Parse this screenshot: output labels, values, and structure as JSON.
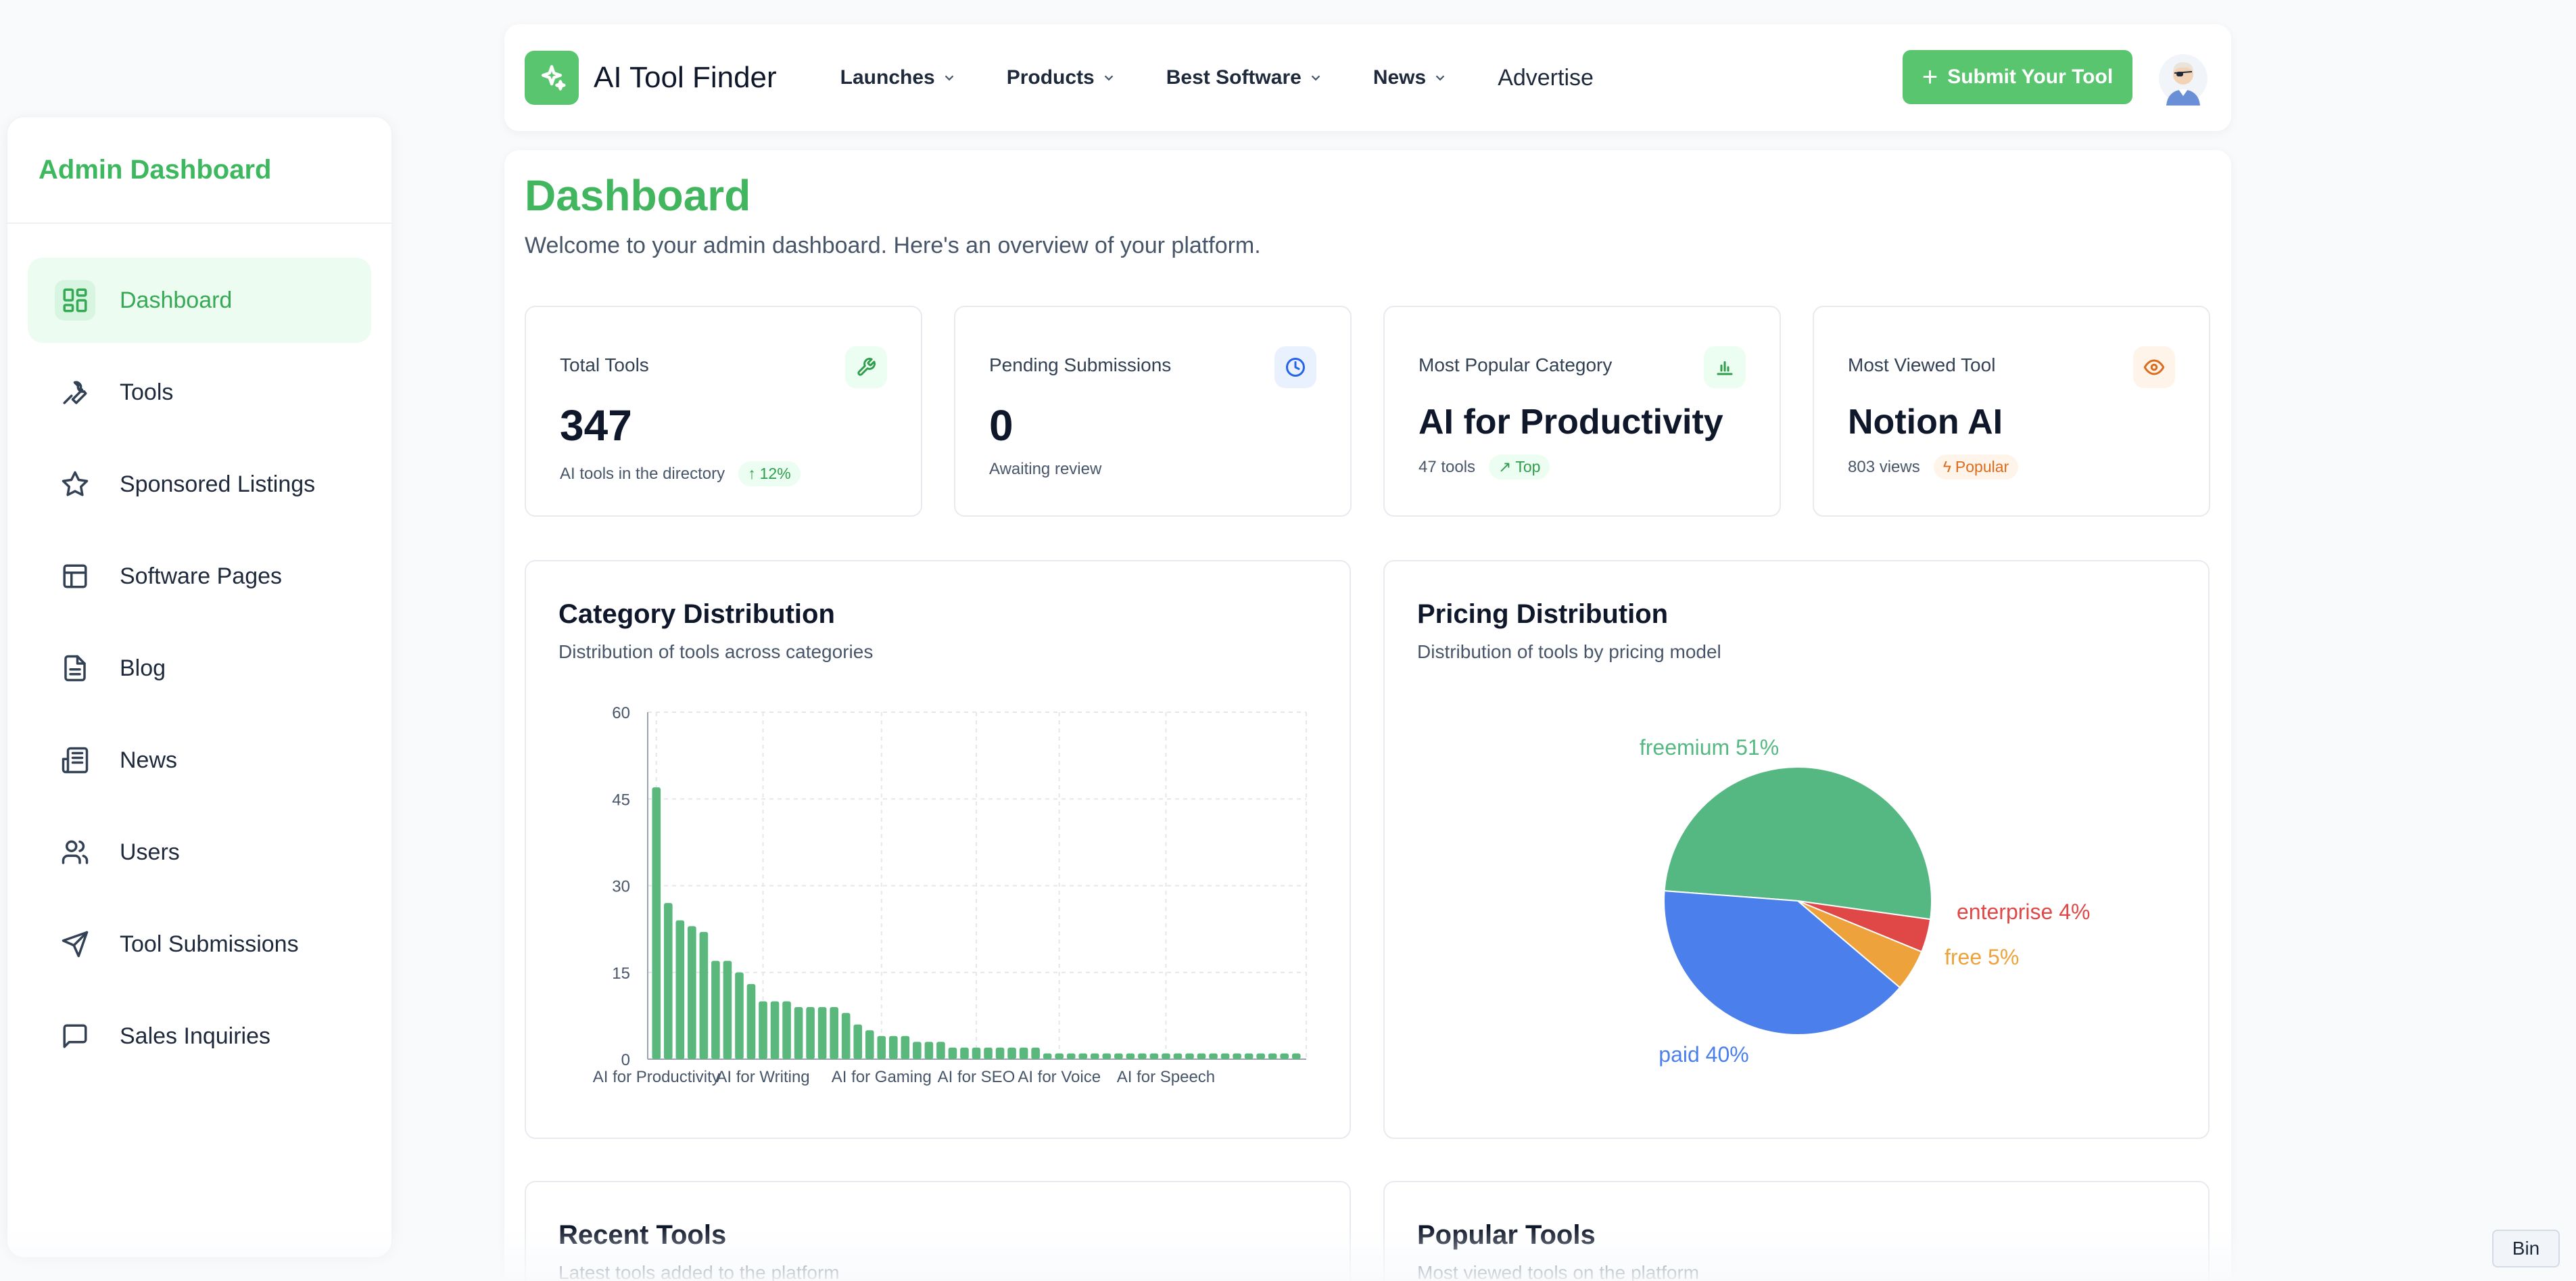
{
  "sidebar": {
    "title": "Admin Dashboard",
    "items": [
      {
        "label": "Dashboard",
        "icon": "dashboard-icon",
        "active": true
      },
      {
        "label": "Tools",
        "icon": "wrench-icon"
      },
      {
        "label": "Sponsored Listings",
        "icon": "star-icon"
      },
      {
        "label": "Software Pages",
        "icon": "layout-icon"
      },
      {
        "label": "Blog",
        "icon": "document-icon"
      },
      {
        "label": "News",
        "icon": "newspaper-icon"
      },
      {
        "label": "Users",
        "icon": "users-icon"
      },
      {
        "label": "Tool Submissions",
        "icon": "send-icon"
      },
      {
        "label": "Sales Inquiries",
        "icon": "message-icon"
      }
    ]
  },
  "header": {
    "brand": "AI Tool Finder",
    "menu": [
      "Launches",
      "Products",
      "Best Software",
      "News"
    ],
    "advertise": "Advertise",
    "submit_label": "Submit Your Tool"
  },
  "page": {
    "title": "Dashboard",
    "subtitle": "Welcome to your admin dashboard. Here's an overview of your platform."
  },
  "stats": [
    {
      "label": "Total Tools",
      "value": "347",
      "foot": "AI tools in the directory",
      "badge": "12%",
      "icon": "wrench-icon",
      "accent": "#2f9e4c"
    },
    {
      "label": "Pending Submissions",
      "value": "0",
      "foot": "Awaiting review",
      "badge": "",
      "icon": "clock-icon",
      "accent": "#2563eb"
    },
    {
      "label": "Most Popular Category",
      "value": "AI for Productivity",
      "foot": "47 tools",
      "badge": "Top",
      "icon": "bar-chart-icon",
      "accent": "#2f9e4c"
    },
    {
      "label": "Most Viewed Tool",
      "value": "Notion AI",
      "foot": "803 views",
      "badge": "Popular",
      "icon": "eye-icon",
      "accent": "#dc6b1d"
    }
  ],
  "category_panel": {
    "title": "Category Distribution",
    "subtitle": "Distribution of tools across categories"
  },
  "pricing_panel": {
    "title": "Pricing Distribution",
    "subtitle": "Distribution of tools by pricing model"
  },
  "recent_panel": {
    "title": "Recent Tools",
    "subtitle": "Latest tools added to the platform"
  },
  "popular_panel": {
    "title": "Popular Tools",
    "subtitle": "Most viewed tools on the platform"
  },
  "bin_label": "Bin",
  "chart_data": [
    {
      "type": "bar",
      "ylim": [
        0,
        60
      ],
      "yticks": [
        0,
        15,
        30,
        45,
        60
      ],
      "grid": true,
      "tick_labels": [
        "AI for Productivity",
        "AI for Writing",
        "AI for Gaming",
        "AI for SEO",
        "AI for Voice",
        "AI for Speech"
      ],
      "tick_positions": [
        0,
        9,
        19,
        27,
        34,
        43
      ],
      "values": [
        47,
        27,
        24,
        23,
        22,
        17,
        17,
        15,
        13,
        10,
        10,
        10,
        9,
        9,
        9,
        9,
        8,
        6,
        5,
        4,
        4,
        4,
        3,
        3,
        3,
        2,
        2,
        2,
        2,
        2,
        2,
        2,
        2,
        1,
        1,
        1,
        1,
        1,
        1,
        1,
        1,
        1,
        1,
        1,
        1,
        1,
        1,
        1,
        1,
        1,
        1,
        1,
        1,
        1,
        1
      ],
      "color": "#5ab87c"
    },
    {
      "type": "pie",
      "slices": [
        {
          "label": "freemium 51%",
          "value": 51,
          "color": "#55b882"
        },
        {
          "label": "enterprise 4%",
          "value": 4,
          "color": "#e04848"
        },
        {
          "label": "free 5%",
          "value": 5,
          "color": "#eea23c"
        },
        {
          "label": "paid 40%",
          "value": 40,
          "color": "#4b80ec"
        }
      ]
    }
  ]
}
